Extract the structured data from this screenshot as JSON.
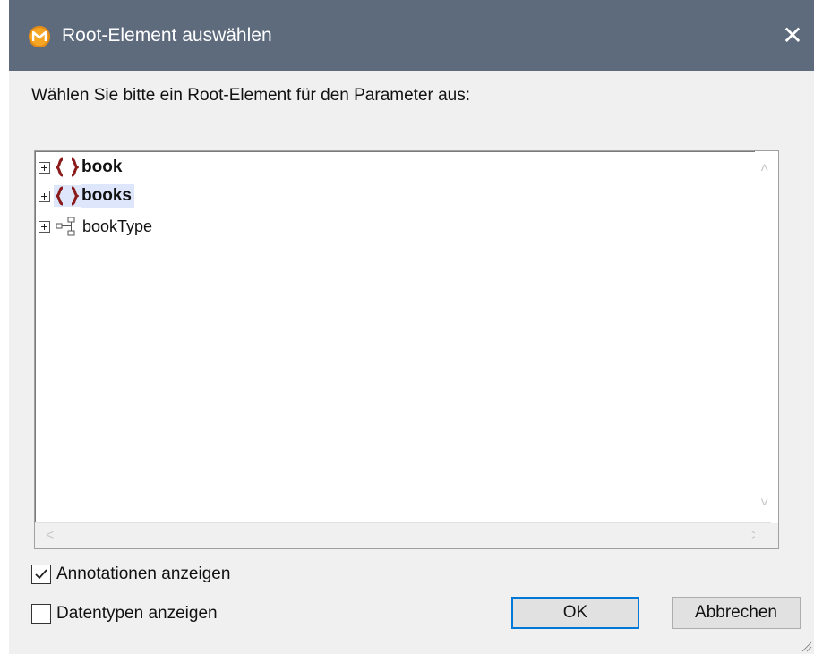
{
  "window": {
    "title": "Root-Element auswählen",
    "close_glyph": "✕",
    "icon": "mapforce-app-icon"
  },
  "prompt": "Wählen Sie bitte ein Root-Element für den Parameter aus:",
  "tree": {
    "items": [
      {
        "label": "book",
        "kind": "element",
        "icon": "element-braces-icon",
        "selected": false
      },
      {
        "label": "books",
        "kind": "element",
        "icon": "element-braces-icon",
        "selected": true
      },
      {
        "label": "bookType",
        "kind": "complex-type",
        "icon": "complex-type-icon",
        "selected": false
      }
    ],
    "scroll_up": "˄",
    "scroll_down": "˅",
    "scroll_left": "<",
    "scroll_right": ">"
  },
  "options": {
    "show_annotations": {
      "label": "Annotationen anzeigen",
      "checked": true
    },
    "show_datatypes": {
      "label": "Datentypen anzeigen",
      "checked": false
    }
  },
  "buttons": {
    "ok": "OK",
    "cancel": "Abbrechen"
  },
  "colors": {
    "titlebar": "#5d6b7d",
    "element_icon": "#8b1a1a",
    "selection": "#dde6fa",
    "default_button_border": "#0078d7"
  }
}
